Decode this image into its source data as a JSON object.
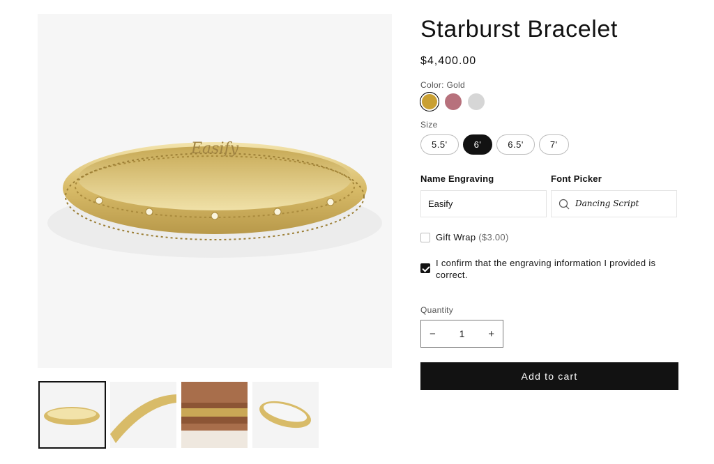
{
  "product": {
    "title": "Starburst Bracelet",
    "price": "$4,400.00",
    "main_image_engraving": "Easify"
  },
  "options": {
    "color_label": "Color: Gold",
    "colors": [
      {
        "name": "Gold",
        "hex": "#c9a033",
        "selected": true
      },
      {
        "name": "Rose",
        "hex": "#b7717c",
        "selected": false
      },
      {
        "name": "Silver",
        "hex": "#d6d6d6",
        "selected": false
      }
    ],
    "size_label": "Size",
    "sizes": [
      {
        "label": "5.5'",
        "selected": false
      },
      {
        "label": "6'",
        "selected": true
      },
      {
        "label": "6.5'",
        "selected": false
      },
      {
        "label": "7'",
        "selected": false
      }
    ]
  },
  "personalization": {
    "engraving_label": "Name Engraving",
    "engraving_value": "Easify",
    "font_label": "Font Picker",
    "font_value": "Dancing Script"
  },
  "checkboxes": {
    "gift_wrap_label": "Gift Wrap",
    "gift_wrap_price": "($3.00)",
    "gift_wrap_checked": false,
    "confirm_label": "I confirm that the engraving information I provided is correct.",
    "confirm_checked": true
  },
  "quantity": {
    "label": "Quantity",
    "value": "1",
    "minus": "−",
    "plus": "+"
  },
  "actions": {
    "add_to_cart": "Add to cart"
  },
  "thumbnails": [
    {
      "name": "bracelet-front",
      "active": true
    },
    {
      "name": "bracelet-detail",
      "active": false
    },
    {
      "name": "bracelet-on-wrist",
      "active": false
    },
    {
      "name": "bracelet-angle",
      "active": false
    }
  ],
  "colors": {
    "gold_light": "#f1dfa0",
    "gold_mid": "#d9bc6a",
    "gold_dark": "#a98a3c",
    "primary": "#121212"
  }
}
